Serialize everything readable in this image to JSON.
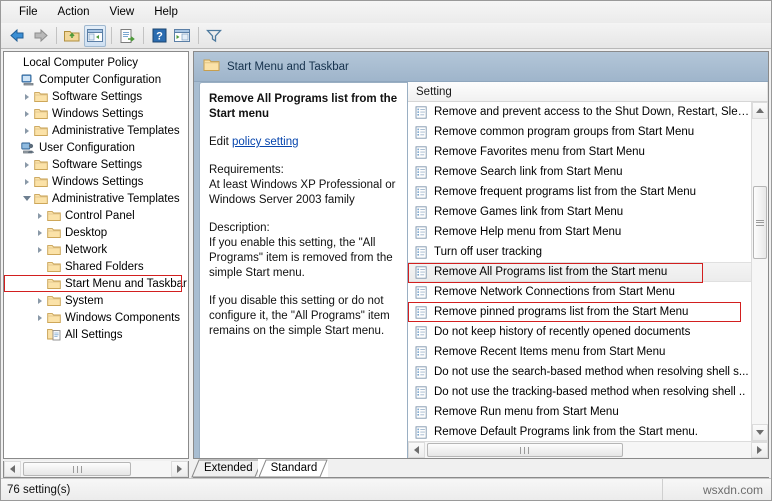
{
  "window": {
    "menu": [
      "File",
      "Action",
      "View",
      "Help"
    ],
    "toolbar": [
      {
        "name": "back-icon",
        "pressed": false
      },
      {
        "name": "forward-icon",
        "pressed": false
      },
      {
        "name": "up-folder-icon",
        "pressed": false
      },
      {
        "name": "show-hide-tree-icon",
        "pressed": true
      },
      {
        "name": "export-list-icon",
        "pressed": false
      },
      {
        "name": "help-icon",
        "pressed": false
      },
      {
        "name": "properties-icon",
        "pressed": false
      },
      {
        "name": "filter-icon",
        "pressed": false
      }
    ]
  },
  "tree": {
    "items": [
      {
        "label": "Local Computer Policy",
        "depth": 0,
        "twisty": "none",
        "icon": "none"
      },
      {
        "label": "Computer Configuration",
        "depth": 0,
        "twisty": "none",
        "icon": "computer"
      },
      {
        "label": "Software Settings",
        "depth": 1,
        "twisty": "closed",
        "icon": "folder"
      },
      {
        "label": "Windows Settings",
        "depth": 1,
        "twisty": "closed",
        "icon": "folder"
      },
      {
        "label": "Administrative Templates",
        "depth": 1,
        "twisty": "closed",
        "icon": "folder"
      },
      {
        "label": "User Configuration",
        "depth": 0,
        "twisty": "none",
        "icon": "user"
      },
      {
        "label": "Software Settings",
        "depth": 1,
        "twisty": "closed",
        "icon": "folder"
      },
      {
        "label": "Windows Settings",
        "depth": 1,
        "twisty": "closed",
        "icon": "folder"
      },
      {
        "label": "Administrative Templates",
        "depth": 1,
        "twisty": "open",
        "icon": "folder"
      },
      {
        "label": "Control Panel",
        "depth": 2,
        "twisty": "closed",
        "icon": "folder"
      },
      {
        "label": "Desktop",
        "depth": 2,
        "twisty": "closed",
        "icon": "folder"
      },
      {
        "label": "Network",
        "depth": 2,
        "twisty": "closed",
        "icon": "folder"
      },
      {
        "label": "Shared Folders",
        "depth": 2,
        "twisty": "none",
        "icon": "folder"
      },
      {
        "label": "Start Menu and Taskbar",
        "depth": 2,
        "twisty": "none",
        "icon": "folder",
        "highlight": true
      },
      {
        "label": "System",
        "depth": 2,
        "twisty": "closed",
        "icon": "folder"
      },
      {
        "label": "Windows Components",
        "depth": 2,
        "twisty": "closed",
        "icon": "folder"
      },
      {
        "label": "All Settings",
        "depth": 2,
        "twisty": "none",
        "icon": "allsettings"
      }
    ]
  },
  "right_panel": {
    "header_title": "Start Menu and Taskbar",
    "header_icon": "folder-icon",
    "description": {
      "title": "Remove All Programs list from the Start menu",
      "edit_prefix": "Edit ",
      "edit_link": "policy setting",
      "requirements_label": "Requirements:",
      "requirements_text": "At least Windows XP Professional or Windows Server 2003 family",
      "description_label": "Description:",
      "paragraph1": "If you enable this setting, the \"All Programs\" item is removed from the simple Start menu.",
      "paragraph2": "If you disable this setting or do not configure it, the \"All Programs\" item remains on the simple Start menu."
    },
    "list": {
      "column_header": "Setting",
      "rows": [
        {
          "label": "Remove and prevent access to the Shut Down, Restart, Sleep..",
          "selected": false,
          "boxed": false
        },
        {
          "label": "Remove common program groups from Start Menu",
          "selected": false,
          "boxed": false
        },
        {
          "label": "Remove Favorites menu from Start Menu",
          "selected": false,
          "boxed": false
        },
        {
          "label": "Remove Search link from Start Menu",
          "selected": false,
          "boxed": false
        },
        {
          "label": "Remove frequent programs list from the Start Menu",
          "selected": false,
          "boxed": false
        },
        {
          "label": "Remove Games link from Start Menu",
          "selected": false,
          "boxed": false
        },
        {
          "label": "Remove Help menu from Start Menu",
          "selected": false,
          "boxed": false
        },
        {
          "label": "Turn off user tracking",
          "selected": false,
          "boxed": false
        },
        {
          "label": "Remove All Programs list from the Start menu",
          "selected": true,
          "boxed": true
        },
        {
          "label": "Remove Network Connections from Start Menu",
          "selected": false,
          "boxed": false
        },
        {
          "label": "Remove pinned programs list from the Start Menu",
          "selected": false,
          "boxed": true
        },
        {
          "label": "Do not keep history of recently opened documents",
          "selected": false,
          "boxed": false
        },
        {
          "label": "Remove Recent Items menu from Start Menu",
          "selected": false,
          "boxed": false
        },
        {
          "label": "Do not use the search-based method when resolving shell s...",
          "selected": false,
          "boxed": false
        },
        {
          "label": "Do not use the tracking-based method when resolving shell ..",
          "selected": false,
          "boxed": false
        },
        {
          "label": "Remove Run menu from Start Menu",
          "selected": false,
          "boxed": false
        },
        {
          "label": "Remove Default Programs link from the Start menu.",
          "selected": false,
          "boxed": false
        }
      ]
    }
  },
  "tabs": [
    {
      "label": "Extended",
      "active": false
    },
    {
      "label": "Standard",
      "active": true
    }
  ],
  "statusbar": {
    "text": "76 setting(s)",
    "watermark": "wsxdn.com"
  },
  "colors": {
    "highlight_red": "#d21f1f",
    "header_blue": "#a8bdd1",
    "link_blue": "#0645ad"
  }
}
